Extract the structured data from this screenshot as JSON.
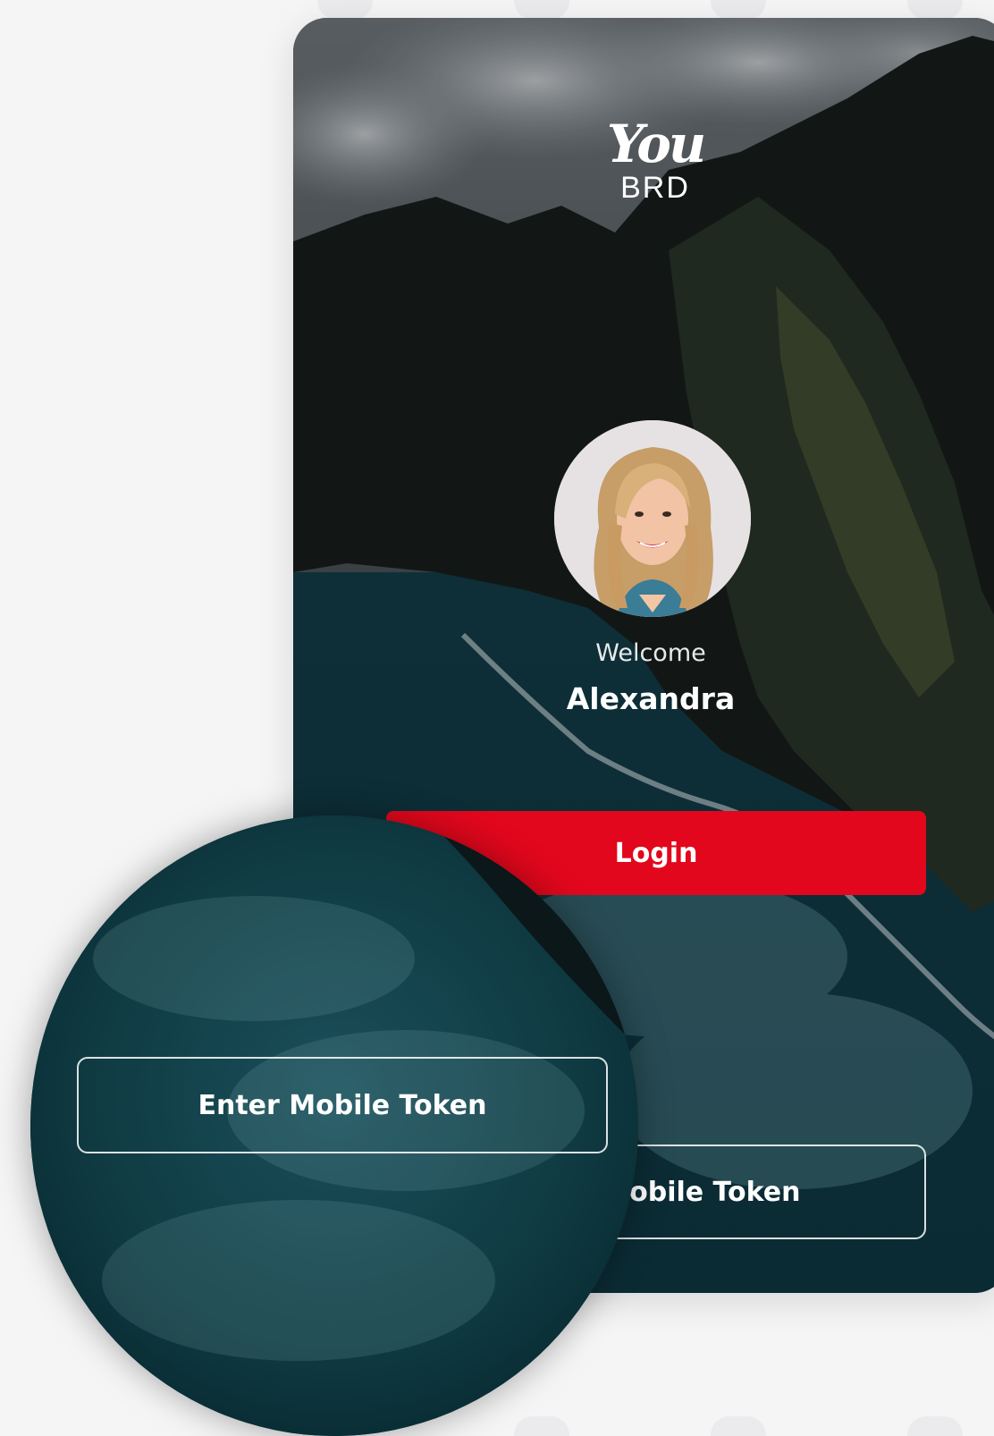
{
  "brand": {
    "logo_top": "You",
    "logo_bottom": "BRD",
    "accent_color": "#e2071c"
  },
  "greeting": {
    "welcome": "Welcome",
    "name": "Alexandra"
  },
  "actions": {
    "login_label": "Login",
    "token_label": "Enter Mobile Token"
  },
  "magnifier": {
    "token_label": "Enter Mobile Token"
  },
  "icons": [
    "avatar-photo",
    "brand-logo"
  ]
}
